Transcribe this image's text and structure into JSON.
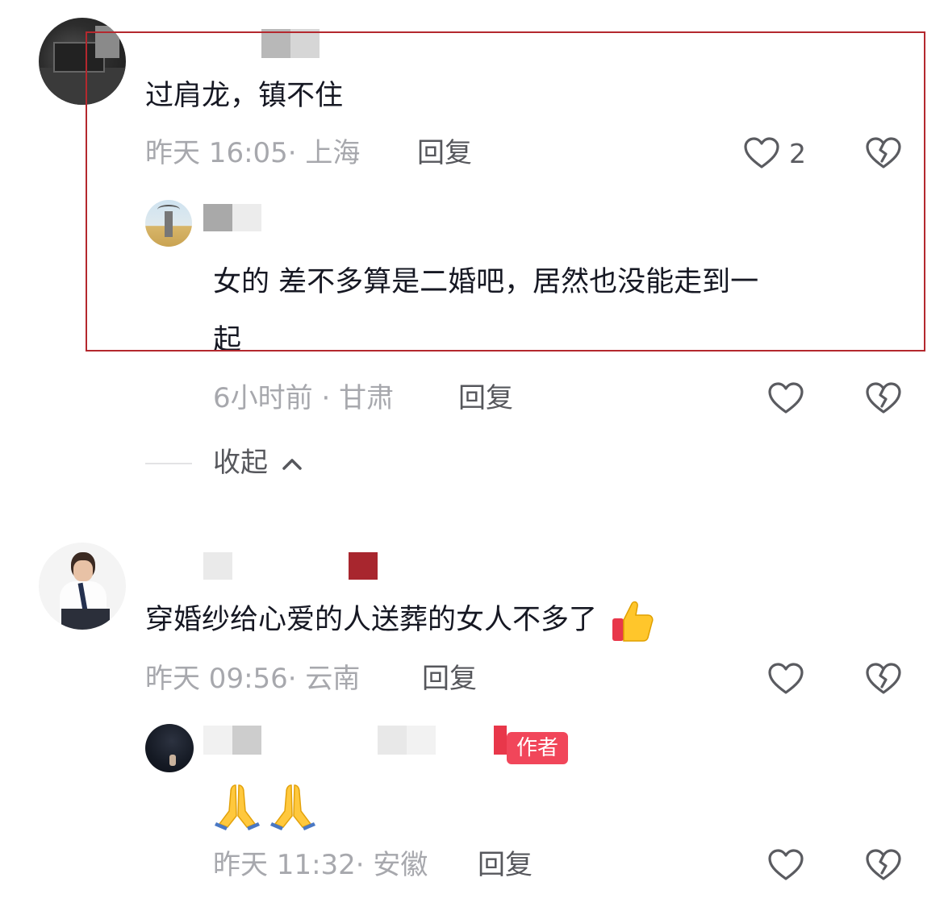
{
  "comments": [
    {
      "text": "过肩龙，镇不住",
      "time": "昨天 16:05",
      "location": "上海",
      "reply_label": "回复",
      "likes": "2",
      "replies": [
        {
          "text_line1": "女的 差不多算是二婚吧，居然也没能走到一",
          "text_line2": "起",
          "time": "6小时前",
          "location": "甘肃",
          "reply_label": "回复"
        }
      ],
      "collapse_label": "收起"
    },
    {
      "text": "穿婚纱给心爱的人送葬的女人不多了",
      "time": "昨天 09:56",
      "location": "云南",
      "reply_label": "回复",
      "replies": [
        {
          "badge": "作者",
          "text": "🙏🙏",
          "time": "昨天 11:32",
          "location": "安徽",
          "reply_label": "回复"
        }
      ]
    }
  ],
  "colors": {
    "highlight_border": "#b4282e",
    "author_badge": "#f1465a",
    "meta_text": "#a7a8ad"
  },
  "icons": {
    "like": "heart-outline-icon",
    "dislike": "broken-heart-icon",
    "collapse": "chevron-up-icon"
  }
}
